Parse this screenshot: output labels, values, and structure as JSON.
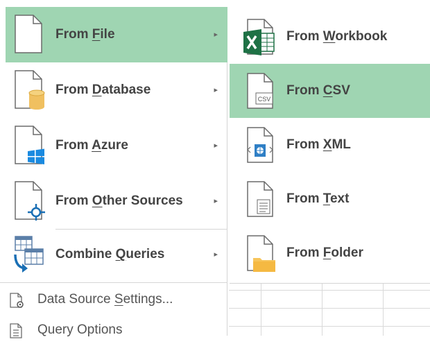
{
  "main_menu": {
    "items": [
      {
        "pre": "From ",
        "key": "F",
        "post": "ile",
        "arrow": "▸",
        "icon": "file-icon"
      },
      {
        "pre": "From ",
        "key": "D",
        "post": "atabase",
        "arrow": "▸",
        "icon": "database-icon"
      },
      {
        "pre": "From ",
        "key": "A",
        "post": "zure",
        "arrow": "▸",
        "icon": "azure-icon"
      },
      {
        "pre": "From ",
        "key": "O",
        "post": "ther Sources",
        "arrow": "▸",
        "icon": "other-sources-icon"
      },
      {
        "pre": "Combine ",
        "key": "Q",
        "post": "ueries",
        "arrow": "▸",
        "icon": "combine-queries-icon"
      }
    ],
    "small_items": [
      {
        "pre": "Data Source ",
        "key": "S",
        "post": "ettings...",
        "icon": "data-source-settings-icon"
      },
      {
        "pre": "Query Options",
        "key": "",
        "post": "",
        "icon": "query-options-icon"
      }
    ]
  },
  "submenu": {
    "items": [
      {
        "pre": "From ",
        "key": "W",
        "post": "orkbook",
        "icon": "excel-workbook-icon"
      },
      {
        "pre": "From ",
        "key": "C",
        "post": "SV",
        "icon": "csv-file-icon",
        "badge": "CSV"
      },
      {
        "pre": "From ",
        "key": "X",
        "post": "ML",
        "icon": "xml-file-icon"
      },
      {
        "pre": "From ",
        "key": "T",
        "post": "ext",
        "icon": "text-file-icon"
      },
      {
        "pre": "From ",
        "key": "F",
        "post": "older",
        "icon": "folder-icon"
      }
    ]
  },
  "colors": {
    "highlight": "#9fd5b2",
    "excel_green": "#1e7145",
    "db_gold": "#f0c060",
    "azure_blue": "#1a8ae0",
    "folder_yellow": "#f7c55b"
  }
}
